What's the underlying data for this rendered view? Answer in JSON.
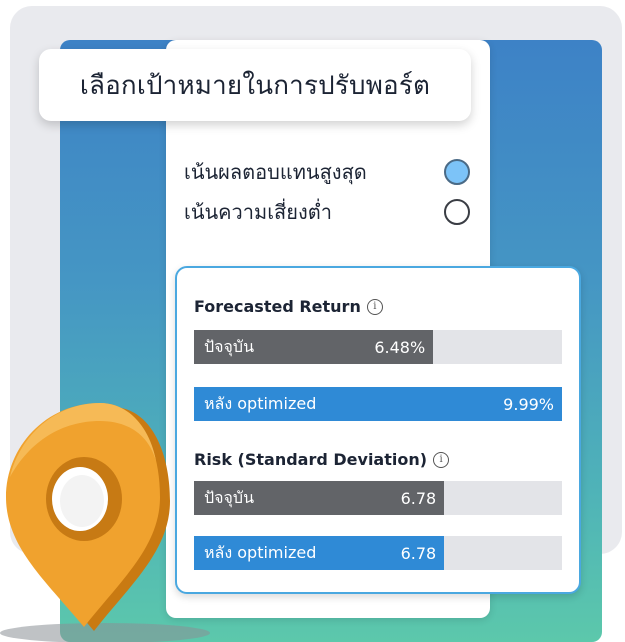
{
  "title": "เลือกเป้าหมายในการปรับพอร์ต",
  "options": [
    {
      "label": "เน้นผลตอบแทนสูงสุด",
      "selected": true
    },
    {
      "label": "เน้นความเสี่ยงต่ำ",
      "selected": false
    }
  ],
  "metrics": {
    "return": {
      "title": "Forecasted Return",
      "info_icon": "info-icon",
      "current": {
        "label": "ปัจจุบัน",
        "value": "6.48%",
        "fraction": 0.65
      },
      "after": {
        "label": "หลัง optimized",
        "value": "9.99%",
        "fraction": 1.0
      }
    },
    "risk": {
      "title": "Risk (Standard Deviation)",
      "info_icon": "info-icon",
      "current": {
        "label": "ปัจจุบัน",
        "value": "6.78",
        "fraction": 0.68
      },
      "after": {
        "label": "หลัง optimized",
        "value": "6.78",
        "fraction": 0.68
      }
    }
  },
  "colors": {
    "selected_radio": "#7cc3f8",
    "current_bar": "#626468",
    "after_bar": "#2f8ad6",
    "card_border": "#4aa8e0",
    "pin": "#f0a22e"
  },
  "decoration": {
    "pin_icon": "location-pin-icon"
  }
}
